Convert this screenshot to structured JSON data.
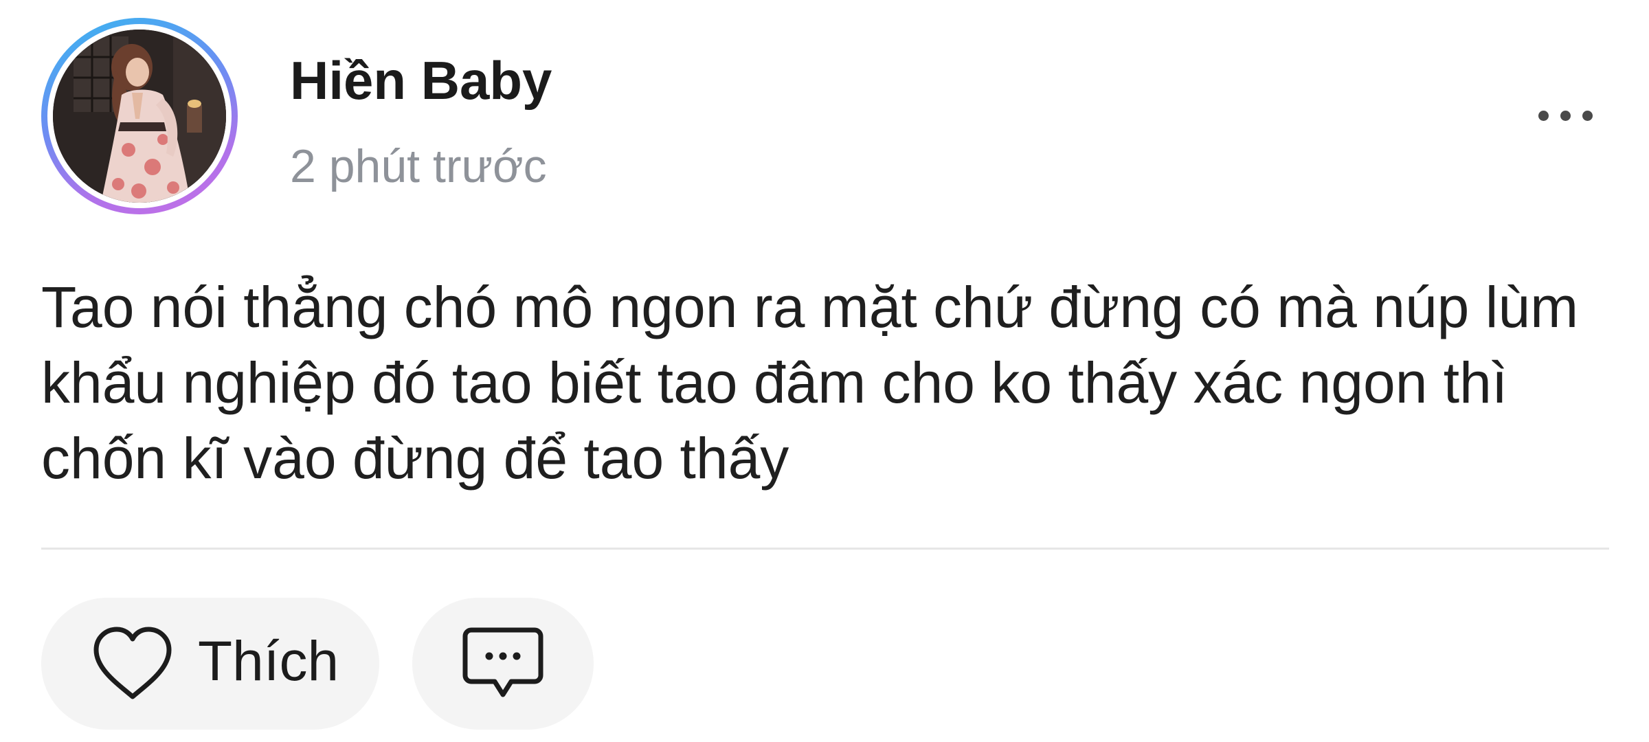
{
  "post": {
    "author": {
      "name": "Hiền Baby",
      "avatar": "profile-photo-avatar"
    },
    "timestamp": "2 phút trước",
    "more_icon": "more-horizontal-icon",
    "text": "Tao nói thẳng chó mô ngon ra mặt chứ đừng có mà núp lùm khẩu nghiệp đó tao biết tao đâm cho ko thấy xác ngon thì chốn kĩ vào đừng để tao thấy",
    "actions": {
      "like": {
        "label": "Thích",
        "icon": "heart-outline-icon"
      },
      "comment": {
        "icon": "comment-bubble-icon"
      }
    }
  },
  "colors": {
    "avatar_ring_start": "#38b6f0",
    "avatar_ring_end": "#c66fe6",
    "timestamp": "#8e9299",
    "action_pill_background": "#f4f4f4",
    "divider": "#e6e6e6"
  }
}
